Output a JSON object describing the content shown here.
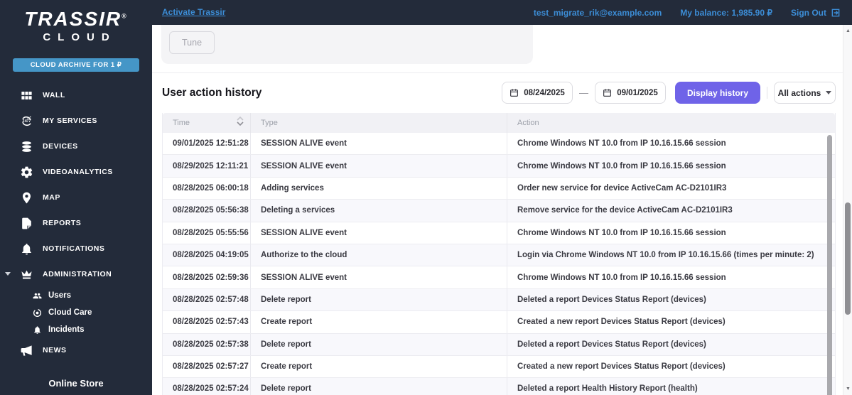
{
  "colors": {
    "dark_bg": "#232B3A",
    "link_blue": "#3C8DD6",
    "archive_blue": "#4596C7",
    "accent_purple": "#6F63E8"
  },
  "topbar": {
    "activate_link": "Activate Trassir",
    "email": "test_migrate_rik@example.com",
    "balance": "My balance: 1,985.90 ₽",
    "sign_out": "Sign Out"
  },
  "sidebar": {
    "logo_line1": "TRASSIR",
    "logo_reg": "®",
    "logo_line2": "CLOUD",
    "archive_button": "CLOUD ARCHIVE FOR 1 ₽",
    "items": [
      {
        "label": "WALL",
        "icon": "wall-icon"
      },
      {
        "label": "MY SERVICES",
        "icon": "my-services-icon"
      },
      {
        "label": "DEVICES",
        "icon": "devices-icon"
      },
      {
        "label": "VIDEOANALYTICS",
        "icon": "videoanalytics-icon"
      },
      {
        "label": "MAP",
        "icon": "map-icon"
      },
      {
        "label": "REPORTS",
        "icon": "reports-icon"
      },
      {
        "label": "NOTIFICATIONS",
        "icon": "notifications-icon"
      },
      {
        "label": "ADMINISTRATION",
        "icon": "administration-icon",
        "expanded": true
      }
    ],
    "admin_subitems": [
      {
        "label": "Users",
        "icon": "users-icon"
      },
      {
        "label": "Cloud Care",
        "icon": "cloud-care-icon"
      },
      {
        "label": "Incidents",
        "icon": "incidents-icon"
      }
    ],
    "news_label": "NEWS",
    "online_store": "Online Store"
  },
  "main": {
    "tune_button": "Tune",
    "title": "User action history",
    "toolbar": {
      "date_from": "08/24/2025",
      "date_separator": "—",
      "date_to": "09/01/2025",
      "display_button": "Display history",
      "filter_dropdown": "All actions"
    },
    "table": {
      "columns": [
        "Time",
        "Type",
        "Action"
      ],
      "rows": [
        {
          "time": "09/01/2025 12:51:28 ...",
          "type": "SESSION ALIVE event",
          "action": "Chrome Windows NT 10.0 from IP 10.16.15.66 session"
        },
        {
          "time": "08/29/2025 12:11:21 ...",
          "type": "SESSION ALIVE event",
          "action": "Chrome Windows NT 10.0 from IP 10.16.15.66 session"
        },
        {
          "time": "08/28/2025 06:00:18 ...",
          "type": "Adding services",
          "action": "Order new service for device ActiveCam AC-D2101IR3"
        },
        {
          "time": "08/28/2025 05:56:38 ...",
          "type": "Deleting a services",
          "action": "Remove service for the device ActiveCam AC-D2101IR3"
        },
        {
          "time": "08/28/2025 05:55:56 ...",
          "type": "SESSION ALIVE event",
          "action": "Chrome Windows NT 10.0 from IP 10.16.15.66 session"
        },
        {
          "time": "08/28/2025 04:19:05 ...",
          "type": "Authorize to the cloud",
          "action": "Login via Chrome Windows NT 10.0 from IP 10.16.15.66 (times per minute: 2)"
        },
        {
          "time": "08/28/2025 02:59:36 ...",
          "type": "SESSION ALIVE event",
          "action": "Chrome Windows NT 10.0 from IP 10.16.15.66 session"
        },
        {
          "time": "08/28/2025 02:57:48 ...",
          "type": "Delete report",
          "action": "Deleted a report Devices Status Report (devices)"
        },
        {
          "time": "08/28/2025 02:57:43 ...",
          "type": "Create report",
          "action": "Created a new report Devices Status Report (devices)"
        },
        {
          "time": "08/28/2025 02:57:38 ...",
          "type": "Delete report",
          "action": "Deleted a report Devices Status Report (devices)"
        },
        {
          "time": "08/28/2025 02:57:27 ...",
          "type": "Create report",
          "action": "Created a new report Devices Status Report (devices)"
        },
        {
          "time": "08/28/2025 02:57:24 ...",
          "type": "Delete report",
          "action": "Deleted a report Health History Report (health)"
        }
      ]
    }
  }
}
